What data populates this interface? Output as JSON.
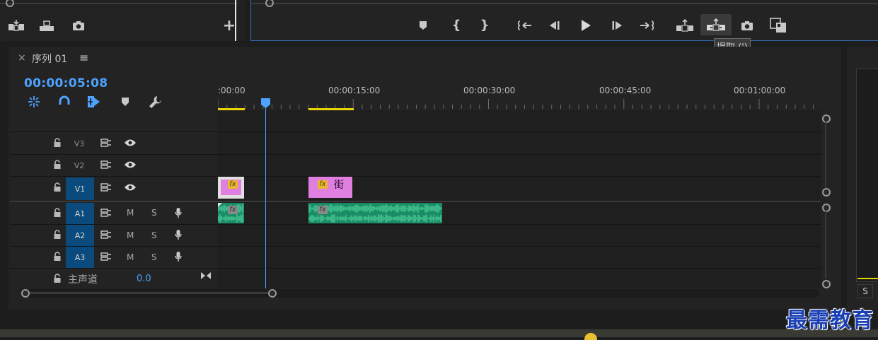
{
  "source_monitor": {
    "buttons": [
      {
        "name": "insert-icon"
      },
      {
        "name": "overwrite-icon"
      },
      {
        "name": "export-frame-icon"
      },
      {
        "name": "add-button-icon",
        "label": "+"
      }
    ]
  },
  "program_monitor": {
    "buttons": [
      {
        "name": "add-marker-icon"
      },
      {
        "name": "mark-in-icon"
      },
      {
        "name": "mark-out-icon"
      },
      {
        "name": "go-to-in-icon"
      },
      {
        "name": "step-back-icon"
      },
      {
        "name": "play-icon"
      },
      {
        "name": "step-forward-icon"
      },
      {
        "name": "go-to-out-icon"
      },
      {
        "name": "lift-icon"
      },
      {
        "name": "extract-icon"
      },
      {
        "name": "export-frame-icon"
      },
      {
        "name": "compare-view-icon"
      }
    ],
    "tooltip": "提取 (')"
  },
  "timeline": {
    "close_glyph": "×",
    "sequence_name": "序列 01",
    "menu_glyph": "≡",
    "current_time": "00:00:05:08",
    "ruler_labels": [
      ":00:00",
      "00:00:15:00",
      "00:00:30:00",
      "00:00:45:00",
      "00:01:00:00"
    ],
    "tools": [
      "snap-icon",
      "linked-selection-icon",
      "add-marker-icon",
      "marker-icon",
      "wrench-icon"
    ],
    "video_tracks": [
      {
        "name": "V3",
        "active": false
      },
      {
        "name": "V2",
        "active": false
      },
      {
        "name": "V1",
        "active": true
      }
    ],
    "audio_tracks": [
      {
        "name": "A1",
        "mute": "M",
        "solo": "S"
      },
      {
        "name": "A2",
        "mute": "M",
        "solo": "S"
      },
      {
        "name": "A3",
        "mute": "M",
        "solo": "S"
      }
    ],
    "master": {
      "label": "主声道",
      "value": "0.0"
    },
    "clips": {
      "v1_clip2_label": "街",
      "fx": "fx"
    }
  },
  "right_panel": {
    "s_label": "S"
  },
  "watermark": "最需教育",
  "colors": {
    "accent_blue": "#4da3ff",
    "video_clip": "#e07fe0",
    "audio_clip": "#1a8d66",
    "work_area": "#e8d400"
  }
}
